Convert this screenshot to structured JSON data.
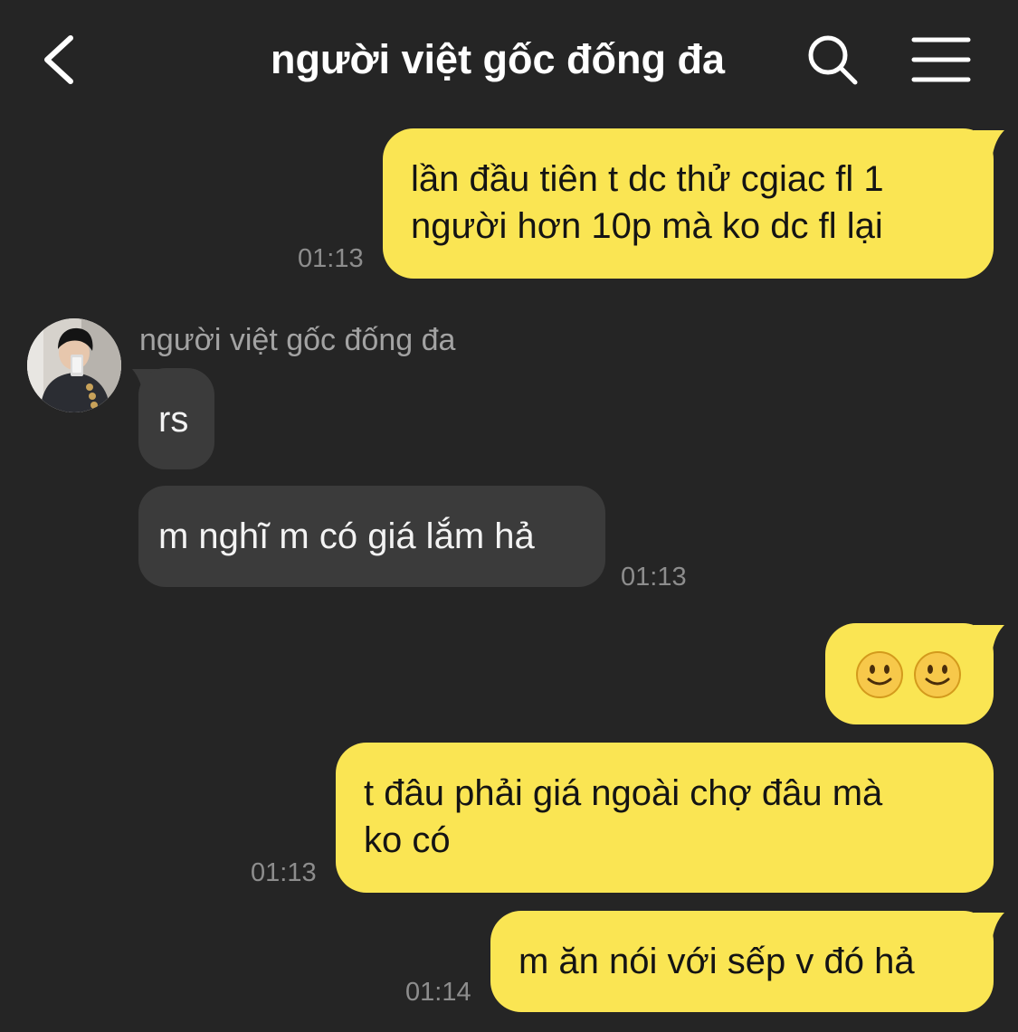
{
  "header": {
    "title": "người việt gốc đống đa",
    "back_icon": "chevron-left-icon",
    "search_icon": "search-icon",
    "menu_icon": "menu-icon"
  },
  "colors": {
    "background": "#252525",
    "my_bubble": "#fae553",
    "their_bubble": "#3b3b3b",
    "timestamp": "#8d8d8d"
  },
  "messages": [
    {
      "from": "me",
      "lines": [
        "lần đầu tiên t dc thử cgiac fl 1",
        "người hơn 10p mà ko dc fl lại"
      ],
      "time": "01:13"
    },
    {
      "from": "them",
      "sender": "người việt gốc đống đa",
      "text": "rs",
      "time": ""
    },
    {
      "from": "them",
      "text": "m nghĩ m có giá lắm hả",
      "time": "01:13"
    },
    {
      "from": "me",
      "emoji": [
        "🙂",
        "🙂"
      ],
      "emoji_name": "slightly-smiling-face",
      "time": ""
    },
    {
      "from": "me",
      "lines": [
        "t đâu phải giá ngoài chợ đâu mà",
        "ko có"
      ],
      "time": "01:13"
    },
    {
      "from": "me",
      "text": "m ăn nói với sếp v đó hả",
      "time": "01:14"
    }
  ]
}
